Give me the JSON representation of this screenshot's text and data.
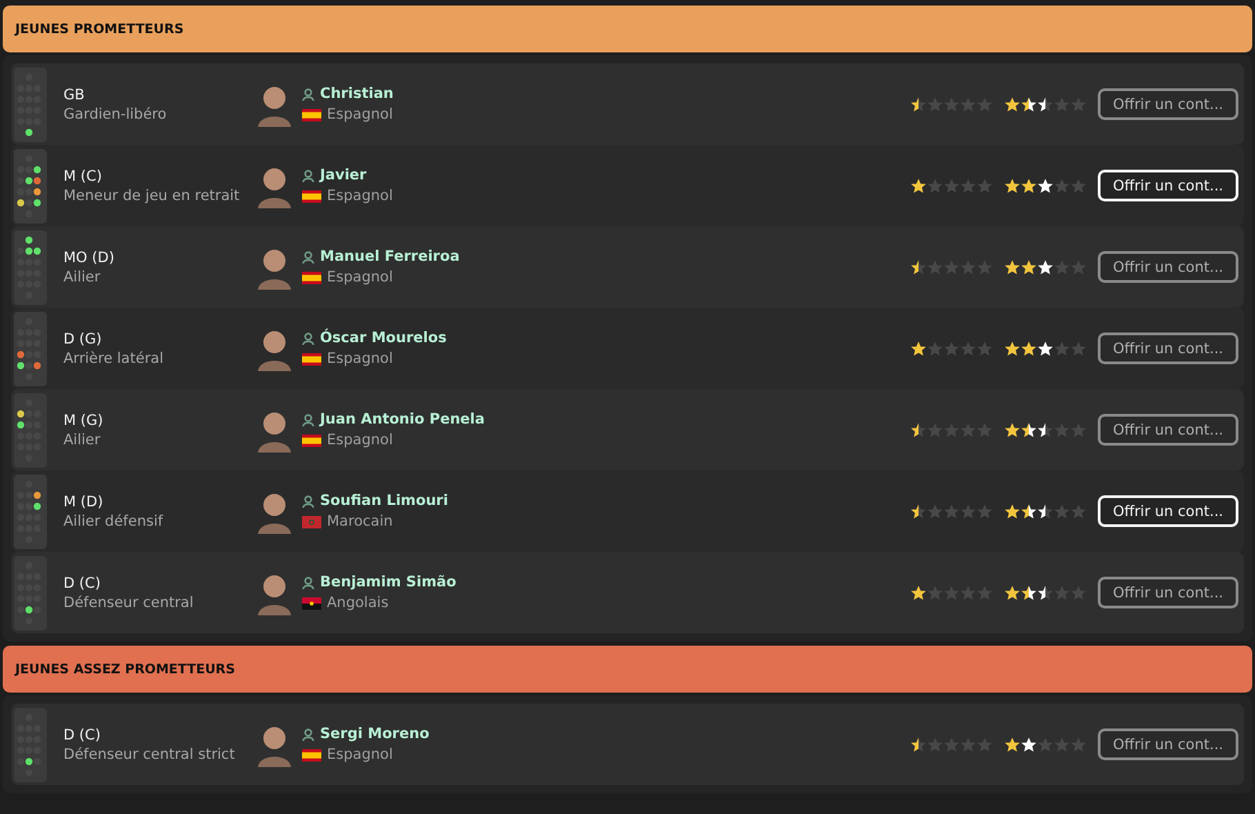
{
  "sections": [
    {
      "title": "JEUNES PROMETTEURS",
      "color": "#e8a05c",
      "players": [
        {
          "position": "GB",
          "role": "Gardien-libéro",
          "name": "Christian",
          "nationality": "Espagnol",
          "flag": {
            "kind": "es"
          },
          "current": {
            "stars": 0.5
          },
          "potential": {
            "stars": 1.5
          },
          "uncertainty": [
            {
              "kind": "none"
            },
            {
              "kind": "right_half"
            },
            {
              "kind": "left_half"
            },
            {
              "kind": "none"
            },
            {
              "kind": "none"
            }
          ],
          "button": "Offrir un cont...",
          "highlighted": false,
          "pitch": [
            [
              {
                "color": "#484848"
              }
            ],
            [
              {
                "color": "#484848"
              },
              {
                "color": "#484848"
              },
              {
                "color": "#484848"
              }
            ],
            [
              {
                "color": "#484848"
              },
              {
                "color": "#484848"
              },
              {
                "color": "#484848"
              }
            ],
            [
              {
                "color": "#484848"
              },
              {
                "color": "#484848"
              },
              {
                "color": "#484848"
              }
            ],
            [
              {
                "color": "#484848"
              },
              {
                "color": "#484848"
              },
              {
                "color": "#484848"
              }
            ],
            [
              {
                "color": "#5fe06a"
              }
            ]
          ]
        },
        {
          "position": "M (C)",
          "role": "Meneur de jeu en retrait",
          "name": "Javier",
          "nationality": "Espagnol",
          "flag": {
            "kind": "es"
          },
          "current": {
            "stars": 1
          },
          "potential": {
            "stars": 2
          },
          "uncertainty": [
            {
              "kind": "none"
            },
            {
              "kind": "none"
            },
            {
              "kind": "full"
            },
            {
              "kind": "none"
            },
            {
              "kind": "none"
            }
          ],
          "button": "Offrir un cont...",
          "highlighted": true,
          "pitch": [
            [
              {
                "color": "#484848"
              }
            ],
            [
              {
                "color": "#484848"
              },
              {
                "color": "#484848"
              },
              {
                "color": "#5fe06a"
              }
            ],
            [
              {
                "color": "#484848"
              },
              {
                "color": "#5fe06a"
              },
              {
                "color": "#e0693a"
              }
            ],
            [
              {
                "color": "#484848"
              },
              {
                "color": "#484848"
              },
              {
                "color": "#e8973a"
              }
            ],
            [
              {
                "color": "#d9c84a"
              },
              {
                "color": "#484848"
              },
              {
                "color": "#5fe06a"
              }
            ],
            [
              {
                "color": "#484848"
              }
            ]
          ]
        },
        {
          "position": "MO (D)",
          "role": "Ailier",
          "name": "Manuel Ferreiroa",
          "nationality": "Espagnol",
          "flag": {
            "kind": "es"
          },
          "current": {
            "stars": 0.5
          },
          "potential": {
            "stars": 2
          },
          "uncertainty": [
            {
              "kind": "none"
            },
            {
              "kind": "none"
            },
            {
              "kind": "full"
            },
            {
              "kind": "none"
            },
            {
              "kind": "none"
            }
          ],
          "button": "Offrir un cont...",
          "highlighted": false,
          "pitch": [
            [
              {
                "color": "#5fe06a"
              }
            ],
            [
              {
                "color": "#484848"
              },
              {
                "color": "#5fe06a"
              },
              {
                "color": "#5fe06a"
              }
            ],
            [
              {
                "color": "#484848"
              },
              {
                "color": "#484848"
              },
              {
                "color": "#484848"
              }
            ],
            [
              {
                "color": "#484848"
              },
              {
                "color": "#484848"
              },
              {
                "color": "#484848"
              }
            ],
            [
              {
                "color": "#484848"
              },
              {
                "color": "#484848"
              },
              {
                "color": "#484848"
              }
            ],
            [
              {
                "color": "#484848"
              }
            ]
          ]
        },
        {
          "position": "D (G)",
          "role": "Arrière latéral",
          "name": "Óscar Mourelos",
          "nationality": "Espagnol",
          "flag": {
            "kind": "es"
          },
          "current": {
            "stars": 1
          },
          "potential": {
            "stars": 2
          },
          "uncertainty": [
            {
              "kind": "none"
            },
            {
              "kind": "none"
            },
            {
              "kind": "full"
            },
            {
              "kind": "none"
            },
            {
              "kind": "none"
            }
          ],
          "button": "Offrir un cont...",
          "highlighted": false,
          "pitch": [
            [
              {
                "color": "#484848"
              }
            ],
            [
              {
                "color": "#484848"
              },
              {
                "color": "#484848"
              },
              {
                "color": "#484848"
              }
            ],
            [
              {
                "color": "#484848"
              },
              {
                "color": "#484848"
              },
              {
                "color": "#484848"
              }
            ],
            [
              {
                "color": "#e0693a"
              },
              {
                "color": "#484848"
              },
              {
                "color": "#484848"
              }
            ],
            [
              {
                "color": "#5fe06a"
              },
              {
                "color": "#484848"
              },
              {
                "color": "#e0693a"
              }
            ],
            [
              {
                "color": "#484848"
              }
            ]
          ]
        },
        {
          "position": "M (G)",
          "role": "Ailier",
          "name": "Juan Antonio Penela",
          "nationality": "Espagnol",
          "flag": {
            "kind": "es"
          },
          "current": {
            "stars": 0.5
          },
          "potential": {
            "stars": 1.5
          },
          "uncertainty": [
            {
              "kind": "none"
            },
            {
              "kind": "right_half"
            },
            {
              "kind": "left_half"
            },
            {
              "kind": "none"
            },
            {
              "kind": "none"
            }
          ],
          "button": "Offrir un cont...",
          "highlighted": false,
          "pitch": [
            [
              {
                "color": "#484848"
              }
            ],
            [
              {
                "color": "#d9c84a"
              },
              {
                "color": "#484848"
              },
              {
                "color": "#484848"
              }
            ],
            [
              {
                "color": "#5fe06a"
              },
              {
                "color": "#484848"
              },
              {
                "color": "#484848"
              }
            ],
            [
              {
                "color": "#484848"
              },
              {
                "color": "#484848"
              },
              {
                "color": "#484848"
              }
            ],
            [
              {
                "color": "#484848"
              },
              {
                "color": "#484848"
              },
              {
                "color": "#484848"
              }
            ],
            [
              {
                "color": "#484848"
              }
            ]
          ]
        },
        {
          "position": "M (D)",
          "role": "Ailier défensif",
          "name": "Soufian Limouri",
          "nationality": "Marocain",
          "flag": {
            "kind": "ma"
          },
          "current": {
            "stars": 0.5
          },
          "potential": {
            "stars": 1.5
          },
          "uncertainty": [
            {
              "kind": "none"
            },
            {
              "kind": "right_half"
            },
            {
              "kind": "left_half"
            },
            {
              "kind": "none"
            },
            {
              "kind": "none"
            }
          ],
          "button": "Offrir un cont...",
          "highlighted": true,
          "pitch": [
            [
              {
                "color": "#484848"
              }
            ],
            [
              {
                "color": "#484848"
              },
              {
                "color": "#484848"
              },
              {
                "color": "#e8973a"
              }
            ],
            [
              {
                "color": "#484848"
              },
              {
                "color": "#484848"
              },
              {
                "color": "#5fe06a"
              }
            ],
            [
              {
                "color": "#484848"
              },
              {
                "color": "#484848"
              },
              {
                "color": "#484848"
              }
            ],
            [
              {
                "color": "#484848"
              },
              {
                "color": "#484848"
              },
              {
                "color": "#484848"
              }
            ],
            [
              {
                "color": "#484848"
              }
            ]
          ]
        },
        {
          "position": "D (C)",
          "role": "Défenseur central",
          "name": "Benjamim Simão",
          "nationality": "Angolais",
          "flag": {
            "kind": "ao"
          },
          "current": {
            "stars": 1
          },
          "potential": {
            "stars": 1.5
          },
          "uncertainty": [
            {
              "kind": "none"
            },
            {
              "kind": "right_half"
            },
            {
              "kind": "left_half"
            },
            {
              "kind": "none"
            },
            {
              "kind": "none"
            }
          ],
          "button": "Offrir un cont...",
          "highlighted": false,
          "pitch": [
            [
              {
                "color": "#484848"
              }
            ],
            [
              {
                "color": "#484848"
              },
              {
                "color": "#484848"
              },
              {
                "color": "#484848"
              }
            ],
            [
              {
                "color": "#484848"
              },
              {
                "color": "#484848"
              },
              {
                "color": "#484848"
              }
            ],
            [
              {
                "color": "#484848"
              },
              {
                "color": "#484848"
              },
              {
                "color": "#484848"
              }
            ],
            [
              {
                "color": "#484848"
              },
              {
                "color": "#5fe06a"
              },
              {
                "color": "#484848"
              }
            ],
            [
              {
                "color": "#484848"
              }
            ]
          ]
        }
      ]
    },
    {
      "title": "JEUNES ASSEZ PROMETTEURS",
      "color": "#e07050",
      "players": [
        {
          "position": "D (C)",
          "role": "Défenseur central strict",
          "name": "Sergi Moreno",
          "nationality": "Espagnol",
          "flag": {
            "kind": "es"
          },
          "current": {
            "stars": 0.5
          },
          "potential": {
            "stars": 1
          },
          "uncertainty": [
            {
              "kind": "none"
            },
            {
              "kind": "full"
            },
            {
              "kind": "none"
            },
            {
              "kind": "none"
            },
            {
              "kind": "none"
            }
          ],
          "button": "Offrir un cont...",
          "highlighted": false,
          "pitch": [
            [
              {
                "color": "#484848"
              }
            ],
            [
              {
                "color": "#484848"
              },
              {
                "color": "#484848"
              },
              {
                "color": "#484848"
              }
            ],
            [
              {
                "color": "#484848"
              },
              {
                "color": "#484848"
              },
              {
                "color": "#484848"
              }
            ],
            [
              {
                "color": "#484848"
              },
              {
                "color": "#484848"
              },
              {
                "color": "#484848"
              }
            ],
            [
              {
                "color": "#484848"
              },
              {
                "color": "#5fe06a"
              },
              {
                "color": "#484848"
              }
            ],
            [
              {
                "color": "#484848"
              }
            ]
          ]
        }
      ]
    }
  ]
}
